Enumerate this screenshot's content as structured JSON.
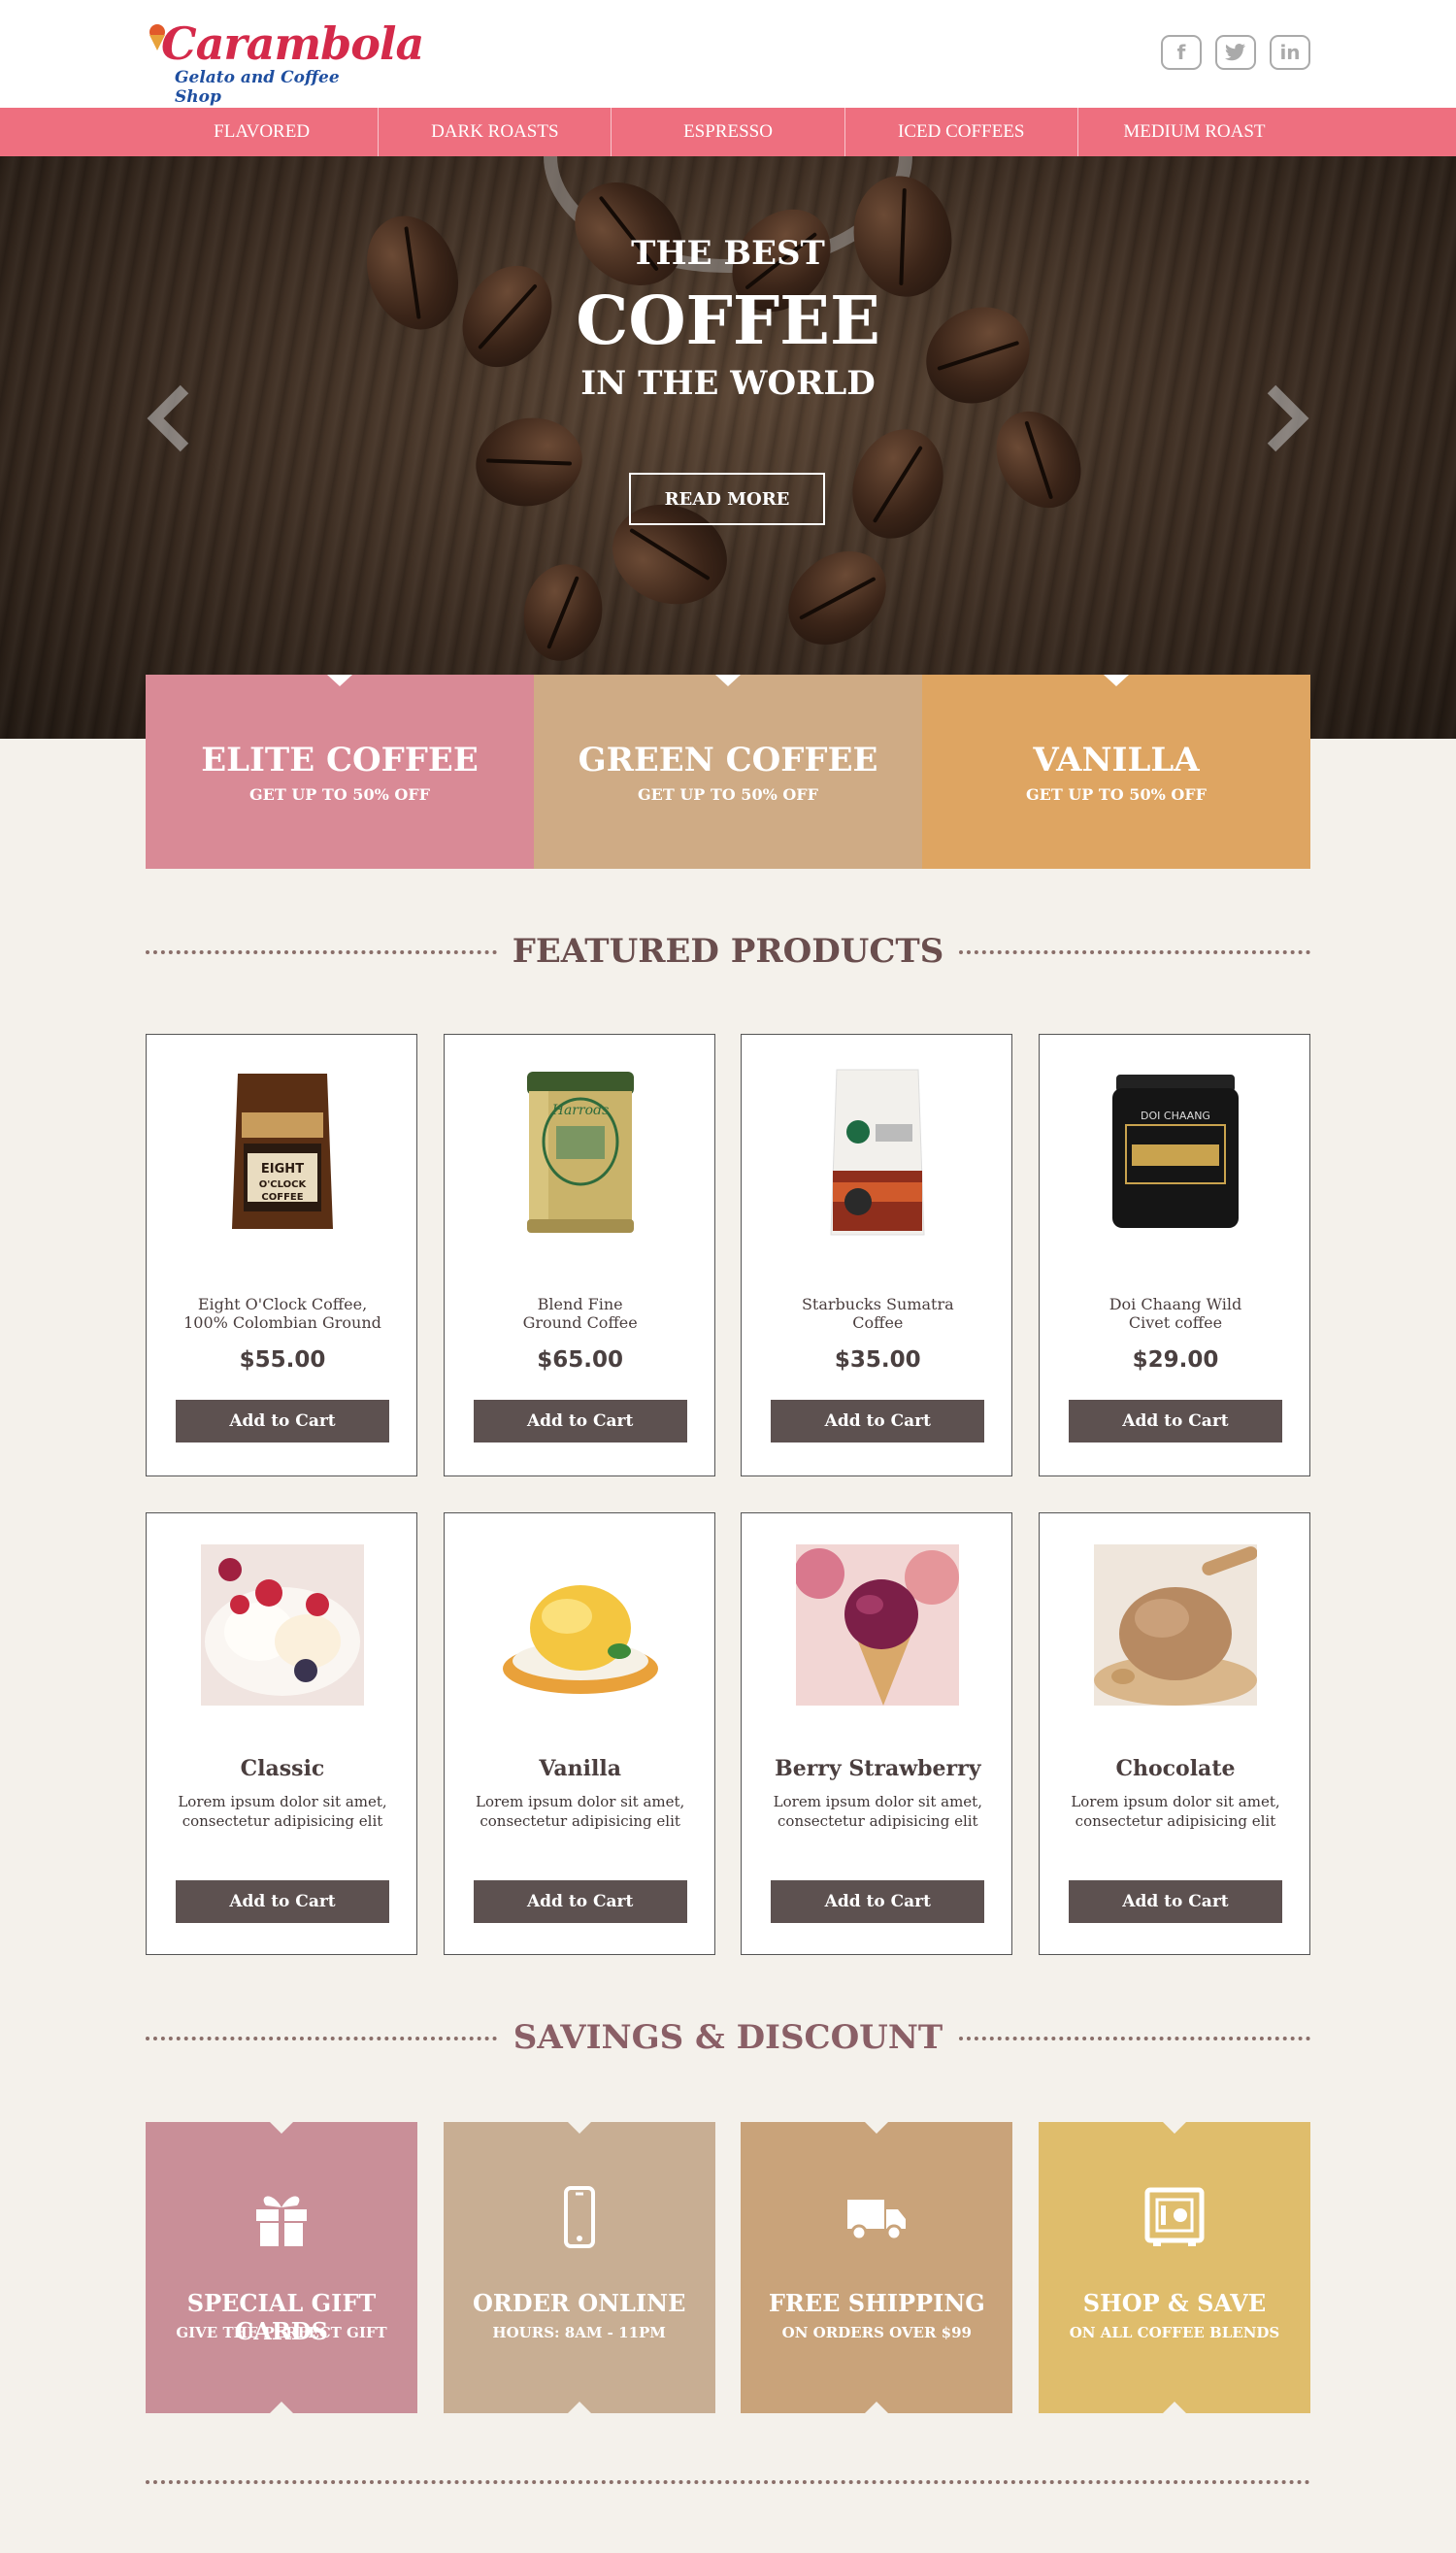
{
  "brand": {
    "name": "Carambola",
    "tagline": "Gelato and Coffee Shop"
  },
  "social": [
    {
      "icon": "facebook-icon",
      "glyph": "f"
    },
    {
      "icon": "twitter-icon",
      "glyph": "t"
    },
    {
      "icon": "linkedin-icon",
      "glyph": "in"
    }
  ],
  "nav": {
    "items": [
      "FLAVORED",
      "DARK ROASTS",
      "ESPRESSO",
      "ICED COFFEES",
      "MEDIUM ROAST"
    ]
  },
  "hero": {
    "line1": "THE BEST",
    "line2": "COFFEE",
    "line3": "IN THE WORLD",
    "button": "READ MORE"
  },
  "promos": [
    {
      "title": "ELITE COFFEE",
      "subtitle": "GET UP TO 50% OFF",
      "color": "#d98a96"
    },
    {
      "title": "GREEN COFFEE",
      "subtitle": "GET UP TO 50% OFF",
      "color": "#cfab85"
    },
    {
      "title": "VANILLA",
      "subtitle": "GET UP TO 50% OFF",
      "color": "#dea562"
    }
  ],
  "featured": {
    "title": "FEATURED PRODUCTS",
    "products": [
      {
        "name_line1": "Eight O'Clock Coffee,",
        "name_line2": "100% Colombian Ground",
        "price": "$55.00",
        "button": "Add to Cart"
      },
      {
        "name_line1": "Blend Fine",
        "name_line2": "Ground Coffee",
        "price": "$65.00",
        "button": "Add to Cart"
      },
      {
        "name_line1": "Starbucks Sumatra",
        "name_line2": "Coffee",
        "price": "$35.00",
        "button": "Add to Cart"
      },
      {
        "name_line1": "Doi Chaang Wild",
        "name_line2": "Civet coffee",
        "price": "$29.00",
        "button": "Add to Cart"
      }
    ],
    "gelato": [
      {
        "name": "Classic",
        "desc_line1": "Lorem ipsum dolor sit amet,",
        "desc_line2": "consectetur adipisicing elit",
        "button": "Add to Cart"
      },
      {
        "name": "Vanilla",
        "desc_line1": "Lorem ipsum dolor sit amet,",
        "desc_line2": "consectetur adipisicing elit",
        "button": "Add to Cart"
      },
      {
        "name": "Berry Strawberry",
        "desc_line1": "Lorem ipsum dolor sit amet,",
        "desc_line2": "consectetur adipisicing elit",
        "button": "Add to Cart"
      },
      {
        "name": "Chocolate",
        "desc_line1": "Lorem ipsum dolor sit amet,",
        "desc_line2": "consectetur adipisicing elit",
        "button": "Add to Cart"
      }
    ]
  },
  "savings": {
    "title": "SAVINGS & DISCOUNT",
    "tiles": [
      {
        "icon": "gift-icon",
        "title": "SPECIAL GIFT CARDS",
        "subtitle": "GIVE THE PERFECT GIFT",
        "color": "#c98f98"
      },
      {
        "icon": "phone-icon",
        "title": "ORDER  ONLINE",
        "subtitle": "HOURS: 8AM - 11PM",
        "color": "#c8ae93"
      },
      {
        "icon": "truck-icon",
        "title": "FREE  SHIPPING",
        "subtitle": "ON ORDERS OVER $99",
        "color": "#c9a37a"
      },
      {
        "icon": "safe-icon",
        "title": "SHOP & SAVE",
        "subtitle": "ON ALL COFFEE BLENDS",
        "color": "#dfbd6c"
      }
    ]
  }
}
